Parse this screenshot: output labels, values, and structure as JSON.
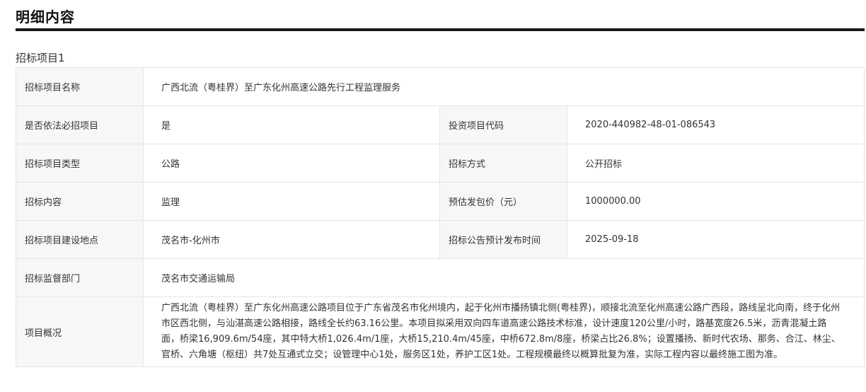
{
  "header": {
    "title": "明细内容"
  },
  "group": {
    "title": "招标项目1"
  },
  "rows": {
    "project_name": {
      "label": "招标项目名称",
      "value": "广西北流（粤桂界）至广东化州高速公路先行工程监理服务"
    },
    "mandatory": {
      "label": "是否依法必招项目",
      "value": "是",
      "label2": "投资项目代码",
      "value2": "2020-440982-48-01-086543"
    },
    "type": {
      "label": "招标项目类型",
      "value": "公路",
      "label2": "招标方式",
      "value2": "公开招标"
    },
    "content": {
      "label": "招标内容",
      "value": "监理",
      "label2": "预估发包价（元）",
      "value2": "1000000.00"
    },
    "location": {
      "label": "招标项目建设地点",
      "value": "茂名市-化州市",
      "label2": "招标公告预计发布时间",
      "value2": "2025-09-18"
    },
    "supervisor": {
      "label": "招标监督部门",
      "value": "茂名市交通运输局"
    },
    "overview": {
      "label": "项目概况",
      "value": "广西北流（粤桂界）至广东化州高速公路项目位于广东省茂名市化州境内，起于化州市播扬镇北侧(粤桂界)，顺接北流至化州高速公路广西段，路线呈北向南，终于化州市区西北侧，与汕湛高速公路相接，路线全长约63.16公里。本项目拟采用双向四车道高速公路技术标准，设计速度120公里/小时，路基宽度26.5米，沥青混凝土路面，桥梁16,909.6m/54座，其中特大桥1,026.4m/1座，大桥15,210.4m/45座，中桥672.8m/8座，桥梁占比26.8%；设置播扬、新时代农场、那务、合江、林尘、官桥、六角塘（枢纽）共7处互通式立交；设管理中心1处，服务区1处，养护工区1处。工程规模最终以概算批复为准，实际工程内容以最终施工图为准。"
    }
  }
}
